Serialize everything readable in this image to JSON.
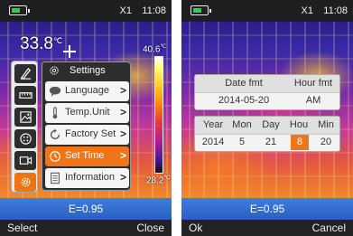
{
  "status": {
    "model": "X1",
    "time": "11:08"
  },
  "screen1": {
    "center_temp_value": "33.8",
    "temp_unit_symbol": "℃",
    "scale_max": "40.6",
    "scale_min": "28.2",
    "scale_unit": "℃",
    "icons": [
      {
        "name": "pencil-ruler-icon",
        "active": false
      },
      {
        "name": "ruler-icon",
        "active": false
      },
      {
        "name": "image-icon",
        "active": false
      },
      {
        "name": "palette-icon",
        "active": false
      },
      {
        "name": "video-icon",
        "active": false
      },
      {
        "name": "gear-icon",
        "active": true
      }
    ],
    "menu": {
      "title": "Settings",
      "items": [
        {
          "label": "Language",
          "icon": "speech-bubble-icon",
          "active": false
        },
        {
          "label": "Temp.Unit",
          "icon": "thermometer-icon",
          "active": false
        },
        {
          "label": "Factory Set",
          "icon": "reset-icon",
          "active": false
        },
        {
          "label": "Set Time",
          "icon": "clock-icon",
          "active": true
        },
        {
          "label": "Information",
          "icon": "document-icon",
          "active": false
        }
      ],
      "chevron": ">"
    },
    "emissivity": "E=0.95",
    "softkey_left": "Select",
    "softkey_right": "Close"
  },
  "screen2": {
    "format_headers": [
      "Date fmt",
      "Hour fmt"
    ],
    "format_values": [
      "2014-05-20",
      "AM"
    ],
    "time_headers": [
      "Year",
      "Mon",
      "Day",
      "Hou",
      "Min"
    ],
    "time_values": [
      "2014",
      "5",
      "21",
      "8",
      "20"
    ],
    "selected_field": "Hou",
    "emissivity": "E=0.95",
    "softkey_left": "Ok",
    "softkey_right": "Cancel"
  },
  "colors": {
    "accent": "#f07518",
    "ebar": "#3e7de0",
    "battery": "#2ed14b"
  }
}
